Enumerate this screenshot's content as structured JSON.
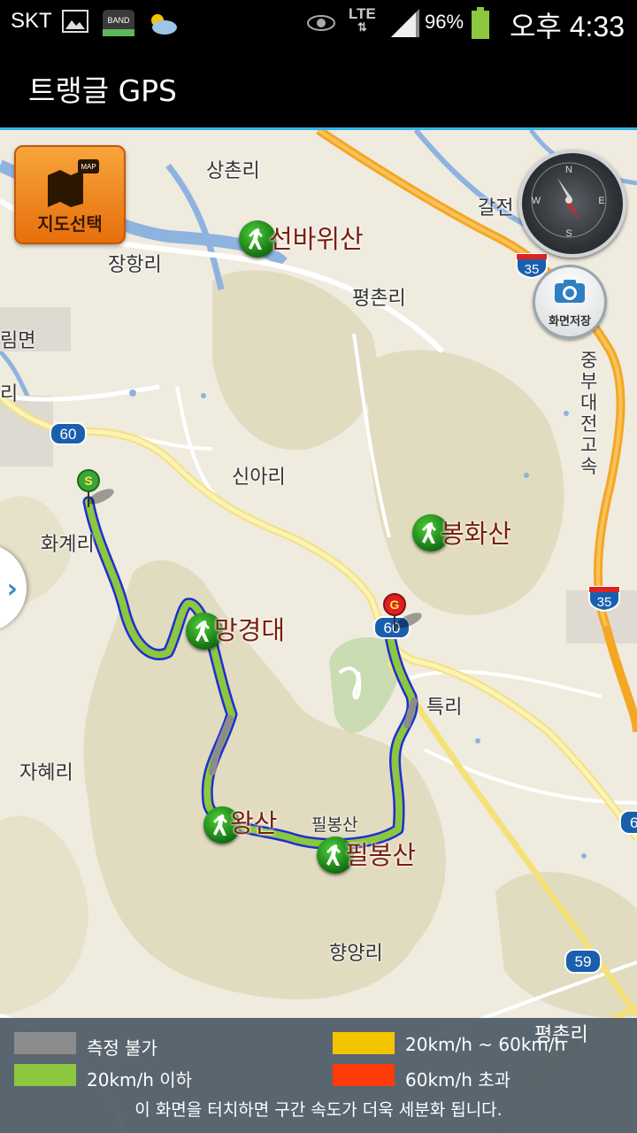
{
  "status_bar": {
    "carrier": "SKT",
    "band_label": "BAND",
    "network": "LTE",
    "battery": "96%",
    "time": "오후 4:33"
  },
  "app": {
    "title": "트랭글 GPS"
  },
  "map": {
    "map_select_badge": "MAP",
    "map_select_label": "지도선택",
    "capture_label": "화면저장",
    "compass_letters": {
      "n": "N",
      "e": "E",
      "s": "S",
      "w": "W"
    },
    "places": {
      "sangchon": "상촌리",
      "galjeon": "갈전",
      "janghang": "장항리",
      "pyeongchon": "평촌리",
      "rimmyeon": "림면",
      "ri_left": "리",
      "sinari": "신아리",
      "hwagye": "화계리",
      "teuk": "특리",
      "jahye": "자혜리",
      "pilbong_small": "필봉산",
      "hyangyang": "향양리",
      "pyeongchon2": "평촌리",
      "expressway": "중부대전고속"
    },
    "peaks": {
      "seonbawi": "선바위산",
      "bonghwa": "봉화산",
      "manggyeong": "망경대",
      "wang": "왕산",
      "pilbong": "필봉산"
    },
    "shields": {
      "r60": "60",
      "r35a": "35",
      "r35b": "35",
      "r59": "59",
      "r60b": "60",
      "r6": "6"
    },
    "start_marker": "S",
    "goal_marker": "G"
  },
  "legend": {
    "items": [
      {
        "label": "측정 불가",
        "color": "#8c8c8c"
      },
      {
        "label": "20km/h ~ 60km/h",
        "color": "#f5c400"
      },
      {
        "label": "20km/h 이하",
        "color": "#8dc63f"
      },
      {
        "label": "60km/h 초과",
        "color": "#ff3b0a"
      }
    ],
    "hint": "이 화면을 터치하면 구간 속도가 더욱 세분화 됩니다."
  },
  "colors": {
    "accent": "#33b5e5",
    "route_slow": "#8dc63f",
    "route_unknown": "#8c8c8c",
    "route_border": "#1e2fd1"
  }
}
